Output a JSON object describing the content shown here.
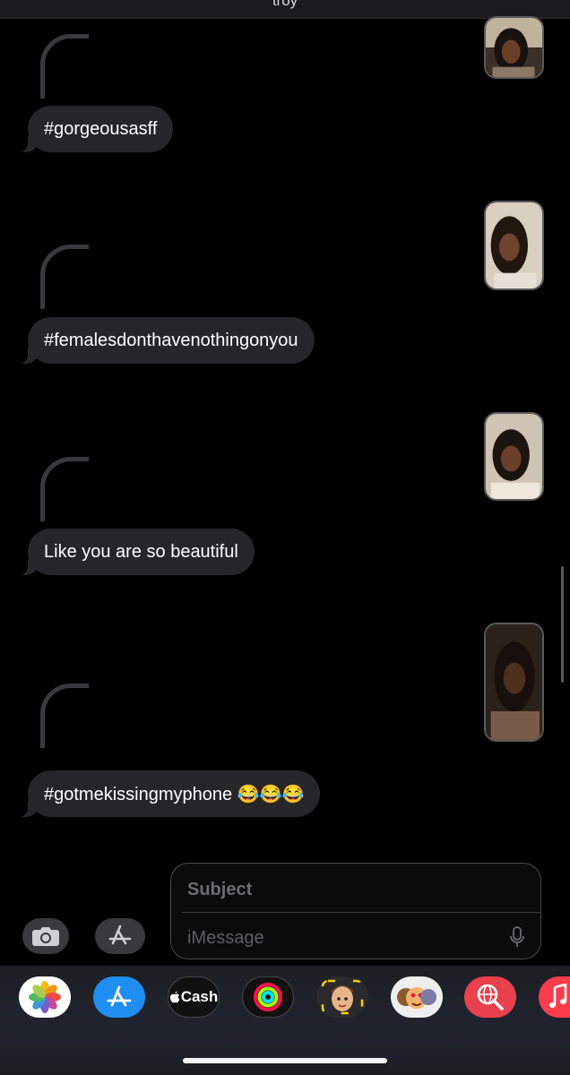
{
  "header": {
    "title": "troy"
  },
  "messages": [
    {
      "text": "#gorgeousasff"
    },
    {
      "text": "#femalesdonthavenothingonyou"
    },
    {
      "text": "Like you are so beautiful"
    },
    {
      "text": "#gotmekissingmyphone 😂😂😂"
    }
  ],
  "compose": {
    "subject_placeholder": "Subject",
    "message_placeholder": "iMessage"
  },
  "dock": {
    "apps": [
      {
        "name": "photos",
        "label": ""
      },
      {
        "name": "app-store",
        "label": ""
      },
      {
        "name": "apple-cash",
        "label": "Cash"
      },
      {
        "name": "activity",
        "label": ""
      },
      {
        "name": "memoji",
        "label": ""
      },
      {
        "name": "animoji-stickers",
        "label": ""
      },
      {
        "name": "web-search",
        "label": ""
      },
      {
        "name": "music",
        "label": ""
      }
    ]
  },
  "colors": {
    "bubble_received": "#262628",
    "reply_line": "#3a3a3d",
    "background": "#000000"
  }
}
